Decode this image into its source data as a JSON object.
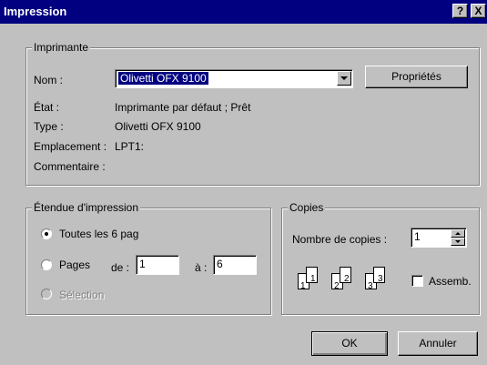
{
  "window": {
    "title": "Impression",
    "help_button": "?",
    "close_button": "X"
  },
  "printer": {
    "group_label": "Imprimante",
    "name_label": "Nom :",
    "name_value": "Olivetti OFX 9100",
    "properties_button": "Propriétés",
    "status_label": "État :",
    "status_value": "Imprimante par défaut ; Prêt",
    "type_label": "Type :",
    "type_value": "Olivetti OFX 9100",
    "location_label": "Emplacement :",
    "location_value": "LPT1:",
    "comment_label": "Commentaire :",
    "comment_value": ""
  },
  "range": {
    "group_label": "Étendue d'impression",
    "all_label": "Toutes les 6 pag",
    "pages_label": "Pages",
    "from_label": "de :",
    "from_value": "1",
    "to_label": "à :",
    "to_value": "6",
    "selection_label": "Sélection",
    "selected_option": "all"
  },
  "copies": {
    "group_label": "Copies",
    "count_label": "Nombre de copies :",
    "count_value": "1",
    "collate_label": "Assemb.",
    "collate_checked": false,
    "collate_pages": [
      "1",
      "1",
      "2",
      "2",
      "3",
      "3"
    ]
  },
  "actions": {
    "ok_label": "OK",
    "cancel_label": "Annuler"
  },
  "icons": {
    "combo_arrow": "chevron-down-icon",
    "spinner": "spinner-icon",
    "collate": "collate-pages-icon"
  },
  "colors": {
    "title_bar": "#000080",
    "dialog_bg": "#c0c0c0",
    "selection_bg": "#000080",
    "disabled_text": "#808080"
  }
}
